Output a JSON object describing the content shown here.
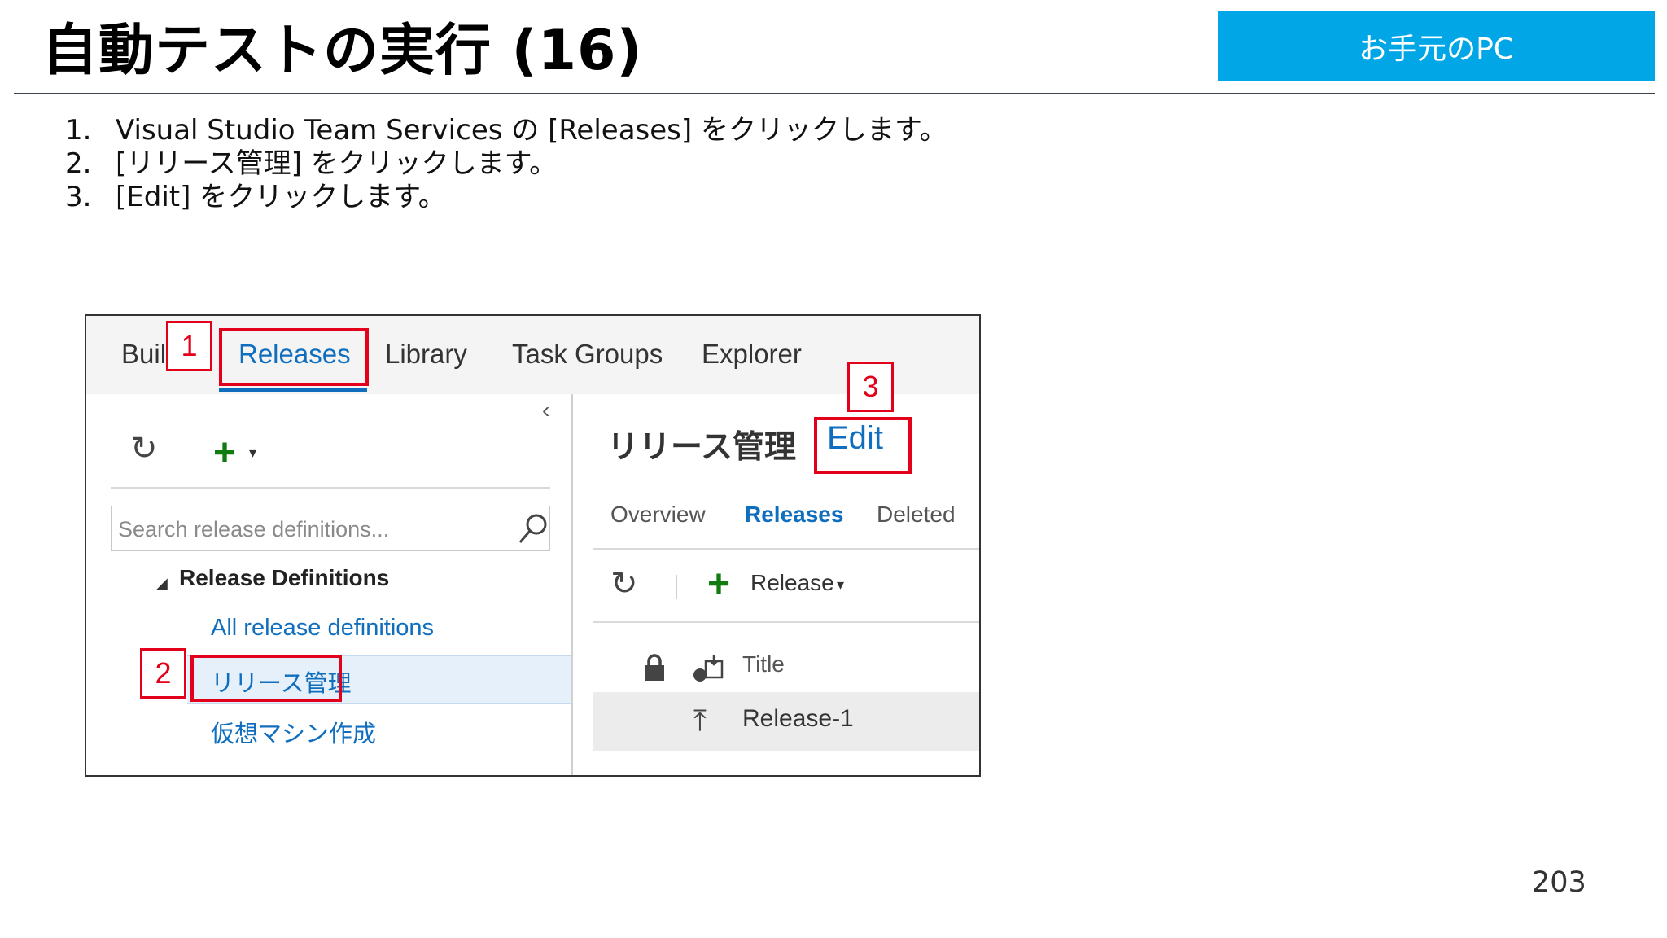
{
  "slide": {
    "title": "自動テストの実行 (16)",
    "badge": "お手元のPC",
    "page_number": "203",
    "steps": [
      {
        "num": "1.",
        "text": "Visual Studio Team Services の [Releases] をクリックします。"
      },
      {
        "num": "2.",
        "text": "[リリース管理] をクリックします。"
      },
      {
        "num": "3.",
        "text": "[Edit] をクリックします。"
      }
    ]
  },
  "screenshot": {
    "hub_tabs": [
      "Buil",
      "Releases",
      "Library",
      "Task Groups",
      "Explorer"
    ],
    "active_tab": "Releases",
    "left_pane": {
      "refresh_glyph": "↻",
      "add_glyph": "+",
      "caret_glyph": "▾",
      "search_placeholder": "Search release definitions...",
      "collapse_glyph": "‹",
      "tree_toggle_glyph": "◢",
      "tree_heading": "Release Definitions",
      "links": [
        "All release definitions",
        "リリース管理",
        "仮想マシン作成"
      ],
      "selected": "リリース管理"
    },
    "right_pane": {
      "definition_title": "リリース管理",
      "edit_label": "Edit",
      "pivots": [
        "Overview",
        "Releases",
        "Deleted"
      ],
      "active_pivot": "Releases",
      "toolbar": {
        "refresh_glyph": "↻",
        "add_glyph": "+",
        "release_label": "Release",
        "caret_glyph": "▾"
      },
      "column_title": "Title",
      "rows": [
        {
          "icon_glyph": "⤒",
          "label": "Release-1"
        }
      ]
    },
    "callouts": [
      "1",
      "2",
      "3"
    ],
    "colors": {
      "accent_blue": "#106ebe",
      "callout_red": "#e3001b",
      "badge_blue": "#00a6e6",
      "add_green": "#107c10"
    }
  }
}
